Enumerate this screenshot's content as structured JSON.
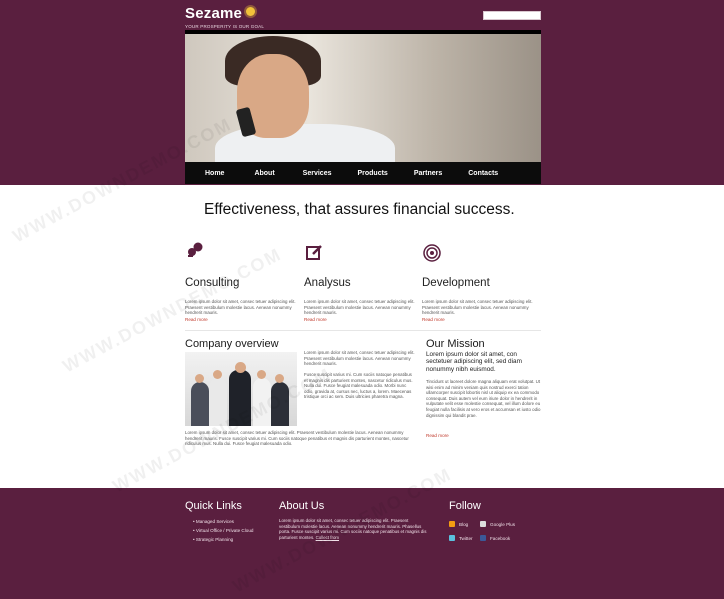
{
  "brand": {
    "name": "Sezame",
    "tagline": "YOUR PROSPERITY IS OUR GOAL",
    "sun_color": "#f2c23a"
  },
  "header": {
    "search_value": ""
  },
  "nav": {
    "items": [
      "Home",
      "About",
      "Services",
      "Products",
      "Partners",
      "Contacts"
    ]
  },
  "headline": "Effectiveness, that assures financial success.",
  "services": [
    {
      "icon": "chat-bubbles-icon",
      "title": "Consulting",
      "text": "Lorem ipsum dolor sit amet, consec tetuer adipiscing elit. Praesent vestibulum molestie lacus. Aenean nonummy hendrerit mauris.",
      "readmore": "Read more"
    },
    {
      "icon": "edit-icon",
      "title": "Analysus",
      "text": "Lorem ipsum dolor sit amet, consec tetuer adipiscing elit. Praesent vestibulum molestie lacus. Aenean nonummy hendrerit mauris.",
      "readmore": "Read more"
    },
    {
      "icon": "target-icon",
      "title": "Development",
      "text": "Lorem ipsum dolor sit amet, consec tetuer adipiscing elit. Praesent vestibulum molestie lacus. Aenean nonummy hendrerit mauris.",
      "readmore": "Read more"
    }
  ],
  "company": {
    "title": "Company overview",
    "text_right": "Lorem ipsum dolor sit amet, consec tetuer adipiscing elit. Praesent vestibulum molestie lacus. Aenean nonummy hendrerit mauris.",
    "text_right2": "Fusce suscipit varius mi. Cum sociis natoque penatibus et magnis dis parturient montes, nascetur ridiculus mus. Nulla dui. Fusce feugiat malesuada odio. Morbi nunc odio, gravida at, cursus nec, luctus a, lorem. Maecenas tristique orci ac sem. Duis ultricies pharetra magna.",
    "text_bottom": "Lorem ipsum dolor sit amet, consec tetuer adipiscing elit. Praesent vestibulum molestie lacus. Aenean nonummy hendrerit mauris. Fusce suscipit varius mi. Cum sociis natoque penatibus et magnis dis parturient montes, nascetur ridiculus mus. Nulla dui. Fusce feugiat malesuada odio."
  },
  "mission": {
    "title": "Our Mission",
    "lead": "Lorem ipsum dolor sit amet, con sectetuer adipiscing elit, sed diam nonummy nibh euismod.",
    "text": "Tincidunt ut laoreet dolore magna aliquam erat volutpat. Ut wisi enim ad minim veniam quis nostrud exerci tation ullamcorper suscipit lobortis nisl ut aliquip ex ea commodo consequat. Duis autem vel eum iriure dolor in hendrerit in vulputate velit esse molestie consequat, vel illum dolore eu feugiat nulla facilisis at vero eros et accumsan et iusto odio dignissim qui blandit prae.",
    "readmore": "Read more"
  },
  "footer": {
    "quick_links_title": "Quick Links",
    "quick_links": [
      "Managed Services",
      "Virtual Office / Private Cloud",
      "Strategic Planning"
    ],
    "about_title": "About Us",
    "about_text": "Lorem ipsum dolor sit amet, consec tetuer adipiscing elit. Praesent vestibulum molestie lacus. Aenean nonummy hendrerit mauris. Phasellus porta. Fusce suscipit varius mi. Cum sociis natoque penatibus et magnis dis parturient montes.",
    "about_link": "Collect from",
    "follow_title": "Follow",
    "follow_links": [
      "Blog",
      "Google Plus",
      "Twitter",
      "Facebook"
    ]
  },
  "watermark_text": "WWW.DOWNDEMO.COM"
}
